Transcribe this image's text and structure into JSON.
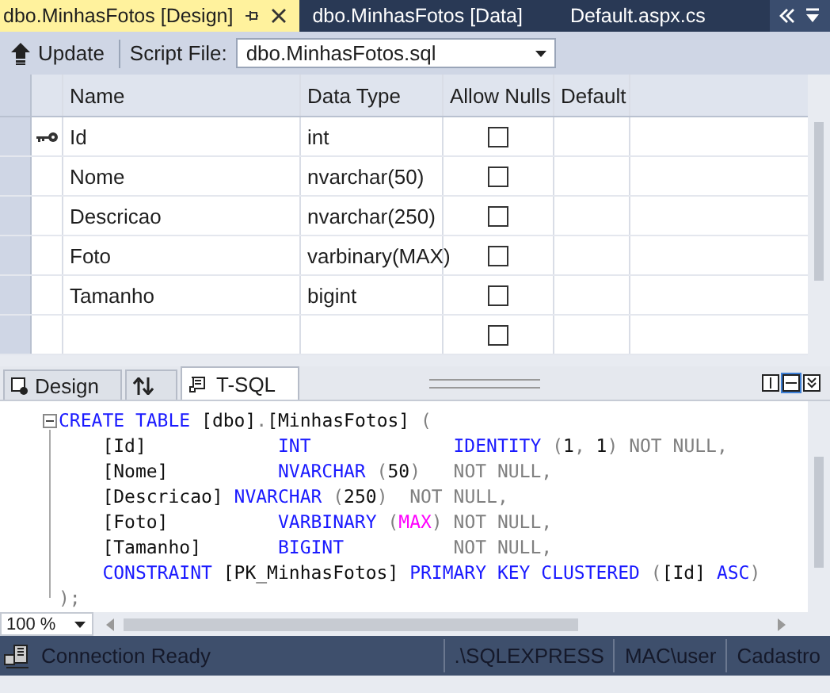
{
  "doc_tabs": [
    {
      "label": "dbo.MinhasFotos [Design]",
      "selected": true
    },
    {
      "label": "dbo.MinhasFotos [Data]",
      "selected": false
    },
    {
      "label": "Default.aspx.cs",
      "selected": false
    }
  ],
  "toolbar": {
    "update": "Update",
    "script_label": "Script File:",
    "script_file": "dbo.MinhasFotos.sql"
  },
  "grid": {
    "columns": [
      "Name",
      "Data Type",
      "Allow Nulls",
      "Default"
    ],
    "rows": [
      {
        "name": "Id",
        "data_type": "int",
        "allow_nulls": false,
        "primary_key": true
      },
      {
        "name": "Nome",
        "data_type": "nvarchar(50)",
        "allow_nulls": false,
        "primary_key": false
      },
      {
        "name": "Descricao",
        "data_type": "nvarchar(250)",
        "allow_nulls": false,
        "primary_key": false
      },
      {
        "name": "Foto",
        "data_type": "varbinary(MAX)",
        "allow_nulls": false,
        "primary_key": false
      },
      {
        "name": "Tamanho",
        "data_type": "bigint",
        "allow_nulls": false,
        "primary_key": false
      },
      {
        "allow_nulls": false,
        "primary_key": false
      }
    ]
  },
  "pane_tabs": [
    {
      "kind": "design",
      "label": "Design",
      "selected": false
    },
    {
      "kind": "swap",
      "selected": false
    },
    {
      "kind": "tsql",
      "label": "T-SQL",
      "selected": true
    }
  ],
  "code": [
    {
      "indent": false,
      "tokens": [
        {
          "kind": "kw",
          "t": "CREATE TABLE"
        },
        {
          "kind": "id",
          "t": " [dbo]"
        },
        {
          "kind": "op",
          "t": "."
        },
        {
          "kind": "id",
          "t": "[MinhasFotos]"
        },
        {
          "kind": "op",
          "t": " ("
        }
      ]
    },
    {
      "indent": true,
      "tokens": [
        {
          "kind": "id",
          "t": "[Id]            "
        },
        {
          "kind": "kw",
          "t": "INT             "
        },
        {
          "kind": "kw",
          "t": "IDENTITY"
        },
        {
          "kind": "op",
          "t": " ("
        },
        {
          "kind": "id",
          "t": "1"
        },
        {
          "kind": "op",
          "t": ", "
        },
        {
          "kind": "id",
          "t": "1"
        },
        {
          "kind": "op",
          "t": ") NOT NULL,"
        }
      ]
    },
    {
      "indent": true,
      "tokens": [
        {
          "kind": "id",
          "t": "[Nome]          "
        },
        {
          "kind": "kw",
          "t": "NVARCHAR"
        },
        {
          "kind": "op",
          "t": " ("
        },
        {
          "kind": "id",
          "t": "50"
        },
        {
          "kind": "op",
          "t": ")   NOT NULL,"
        }
      ]
    },
    {
      "indent": true,
      "tokens": [
        {
          "kind": "id",
          "t": "[Descricao] "
        },
        {
          "kind": "kw",
          "t": "NVARCHAR"
        },
        {
          "kind": "op",
          "t": " ("
        },
        {
          "kind": "id",
          "t": "250"
        },
        {
          "kind": "op",
          "t": ")  NOT NULL,"
        }
      ]
    },
    {
      "indent": true,
      "tokens": [
        {
          "kind": "id",
          "t": "[Foto]          "
        },
        {
          "kind": "kw",
          "t": "VARBINARY"
        },
        {
          "kind": "op",
          "t": " ("
        },
        {
          "kind": "fn",
          "t": "MAX"
        },
        {
          "kind": "op",
          "t": ") NOT NULL,"
        }
      ]
    },
    {
      "indent": true,
      "tokens": [
        {
          "kind": "id",
          "t": "[Tamanho]       "
        },
        {
          "kind": "kw",
          "t": "BIGINT"
        },
        {
          "kind": "op",
          "t": "          NOT NULL,"
        }
      ]
    },
    {
      "indent": true,
      "tokens": [
        {
          "kind": "kw",
          "t": "CONSTRAINT"
        },
        {
          "kind": "id",
          "t": " [PK_MinhasFotos] "
        },
        {
          "kind": "kw",
          "t": "PRIMARY KEY CLUSTERED"
        },
        {
          "kind": "op",
          "t": " ("
        },
        {
          "kind": "id",
          "t": "[Id] "
        },
        {
          "kind": "kw",
          "t": "ASC"
        },
        {
          "kind": "op",
          "t": ")"
        }
      ]
    },
    {
      "indent": false,
      "tokens": [
        {
          "kind": "op",
          "t": ");"
        }
      ]
    }
  ],
  "zoom": "100 %",
  "status_bar": {
    "message": "Connection Ready",
    "server": ".\\SQLEXPRESS",
    "user": "MAC\\user",
    "database": "Cadastro"
  }
}
